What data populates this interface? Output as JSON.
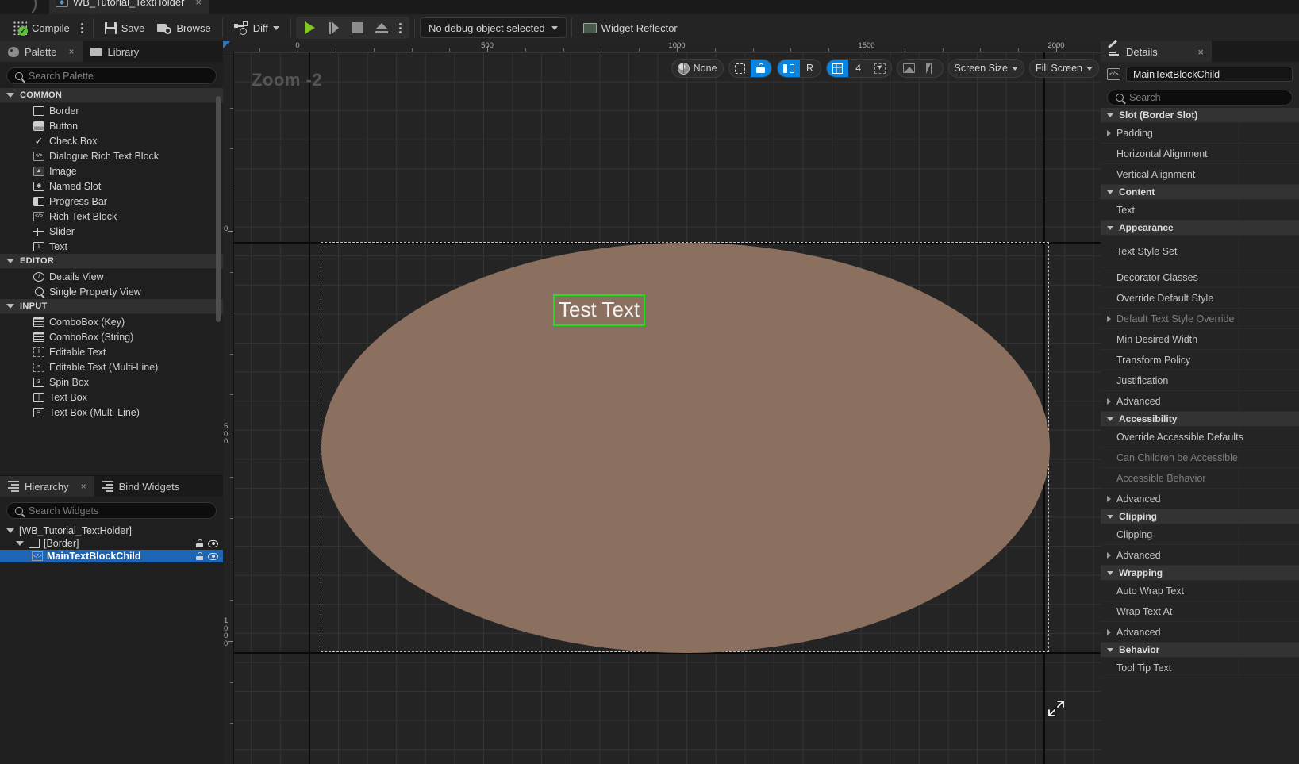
{
  "window": {
    "document_tab": {
      "label": "WB_Tutorial_TextHolder",
      "icon": "widget-blueprint-icon",
      "close": "×"
    }
  },
  "toolbar": {
    "compile_label": "Compile",
    "save_label": "Save",
    "browse_label": "Browse",
    "diff_label": "Diff",
    "play_tooltip": "Play",
    "debug_object": "No debug object selected",
    "widget_reflector_label": "Widget Reflector"
  },
  "palette": {
    "tabs": [
      {
        "label": "Palette",
        "icon": "palette-icon",
        "active": true,
        "close": "×"
      },
      {
        "label": "Library",
        "icon": "library-folder-icon",
        "active": false
      }
    ],
    "search_placeholder": "Search Palette",
    "search_value": "",
    "categories": [
      {
        "name": "COMMON",
        "expanded": true,
        "items": [
          {
            "label": "Border",
            "icon": "border-widget-icon"
          },
          {
            "label": "Button",
            "icon": "button-widget-icon"
          },
          {
            "label": "Check Box",
            "icon": "checkbox-widget-icon"
          },
          {
            "label": "Dialogue Rich Text Block",
            "icon": "rich-text-widget-icon"
          },
          {
            "label": "Image",
            "icon": "image-widget-icon"
          },
          {
            "label": "Named Slot",
            "icon": "named-slot-widget-icon"
          },
          {
            "label": "Progress Bar",
            "icon": "progress-bar-widget-icon"
          },
          {
            "label": "Rich Text Block",
            "icon": "rich-text-widget-icon"
          },
          {
            "label": "Slider",
            "icon": "slider-widget-icon"
          },
          {
            "label": "Text",
            "icon": "text-widget-icon"
          }
        ]
      },
      {
        "name": "EDITOR",
        "expanded": true,
        "items": [
          {
            "label": "Details View",
            "icon": "details-view-icon"
          },
          {
            "label": "Single Property View",
            "icon": "single-property-view-icon"
          }
        ]
      },
      {
        "name": "INPUT",
        "expanded": true,
        "items": [
          {
            "label": "ComboBox (Key)",
            "icon": "combobox-widget-icon"
          },
          {
            "label": "ComboBox (String)",
            "icon": "combobox-widget-icon"
          },
          {
            "label": "Editable Text",
            "icon": "editable-text-widget-icon"
          },
          {
            "label": "Editable Text (Multi-Line)",
            "icon": "editable-text-multiline-widget-icon"
          },
          {
            "label": "Spin Box",
            "icon": "spin-box-widget-icon"
          },
          {
            "label": "Text Box",
            "icon": "text-box-widget-icon"
          },
          {
            "label": "Text Box (Multi-Line)",
            "icon": "text-box-multiline-widget-icon"
          }
        ]
      }
    ]
  },
  "hierarchy": {
    "tabs": [
      {
        "label": "Hierarchy",
        "icon": "hierarchy-icon",
        "active": true,
        "close": "×"
      },
      {
        "label": "Bind Widgets",
        "icon": "bind-widgets-icon",
        "active": false
      }
    ],
    "search_placeholder": "Search Widgets",
    "search_value": "",
    "tree": [
      {
        "label": "[WB_Tutorial_TextHolder]",
        "depth": 0,
        "expanded": true,
        "selected": false,
        "has_icon": false,
        "actions": false
      },
      {
        "label": "[Border]",
        "depth": 1,
        "expanded": true,
        "selected": false,
        "has_icon": true,
        "icon": "border-widget-icon",
        "actions": true
      },
      {
        "label": "MainTextBlockChild",
        "depth": 2,
        "expanded": false,
        "selected": true,
        "has_icon": true,
        "icon": "rich-text-widget-icon",
        "actions": true
      }
    ]
  },
  "viewport": {
    "zoom_label": "Zoom -2",
    "ruler_h_labels": [
      "0",
      "500",
      "1000",
      "1500",
      "2000"
    ],
    "ruler_h_positions": [
      94,
      333,
      572,
      811,
      1050
    ],
    "ruler_v_labels": [
      "0",
      "500",
      "1000"
    ],
    "ruler_v_positions": [
      239,
      497,
      756
    ],
    "widget_text": "Test Text",
    "selection_color": "#22dd22",
    "border_fill_color": "#8b6f5f",
    "toolbar": {
      "none_label": "None",
      "none_icon": "globe-icon",
      "dashed_select_icon": "selection-outline-icon",
      "lock_icon": "lock-icon",
      "localization_icon": "localization-preview-icon",
      "localization_label": "R",
      "grid_icon": "grid-snapping-icon",
      "grid_size": "4",
      "cursor_icon": "cursor-preview-icon",
      "image_icon": "image-preview-icon",
      "mirror_icon": "mirror-flip-icon",
      "screen_size_label": "Screen Size",
      "fill_screen_label": "Fill Screen"
    }
  },
  "details": {
    "tab": {
      "label": "Details",
      "icon": "details-icon",
      "close": "×"
    },
    "object_name": "MainTextBlockChild",
    "object_icon": "rich-text-widget-icon",
    "search_placeholder": "Search",
    "search_value": "",
    "rows": [
      {
        "kind": "category",
        "label": "Slot (Border Slot)",
        "expanded": true
      },
      {
        "kind": "prop",
        "label": "Padding",
        "arrow": "right"
      },
      {
        "kind": "prop",
        "label": "Horizontal Alignment"
      },
      {
        "kind": "prop",
        "label": "Vertical Alignment"
      },
      {
        "kind": "category",
        "label": "Content",
        "expanded": true
      },
      {
        "kind": "prop",
        "label": "Text"
      },
      {
        "kind": "category",
        "label": "Appearance",
        "expanded": true
      },
      {
        "kind": "prop-tall",
        "label": "Text Style Set"
      },
      {
        "kind": "prop",
        "label": "Decorator Classes"
      },
      {
        "kind": "prop",
        "label": "Override Default Style"
      },
      {
        "kind": "prop",
        "label": "Default Text Style Override",
        "arrow": "right",
        "dim": true
      },
      {
        "kind": "prop",
        "label": "Min Desired Width"
      },
      {
        "kind": "prop",
        "label": "Transform Policy"
      },
      {
        "kind": "prop",
        "label": "Justification"
      },
      {
        "kind": "prop",
        "label": "Advanced",
        "arrow": "right"
      },
      {
        "kind": "category",
        "label": "Accessibility",
        "expanded": true
      },
      {
        "kind": "prop",
        "label": "Override Accessible Defaults"
      },
      {
        "kind": "prop",
        "label": "Can Children be Accessible",
        "dim": true
      },
      {
        "kind": "prop",
        "label": "Accessible Behavior",
        "dim": true
      },
      {
        "kind": "prop",
        "label": "Advanced",
        "arrow": "right"
      },
      {
        "kind": "category",
        "label": "Clipping",
        "expanded": true
      },
      {
        "kind": "prop",
        "label": "Clipping"
      },
      {
        "kind": "prop",
        "label": "Advanced",
        "arrow": "right"
      },
      {
        "kind": "category",
        "label": "Wrapping",
        "expanded": true
      },
      {
        "kind": "prop",
        "label": "Auto Wrap Text"
      },
      {
        "kind": "prop",
        "label": "Wrap Text At"
      },
      {
        "kind": "prop",
        "label": "Advanced",
        "arrow": "right"
      },
      {
        "kind": "category",
        "label": "Behavior",
        "expanded": true
      },
      {
        "kind": "prop",
        "label": "Tool Tip Text"
      }
    ]
  }
}
